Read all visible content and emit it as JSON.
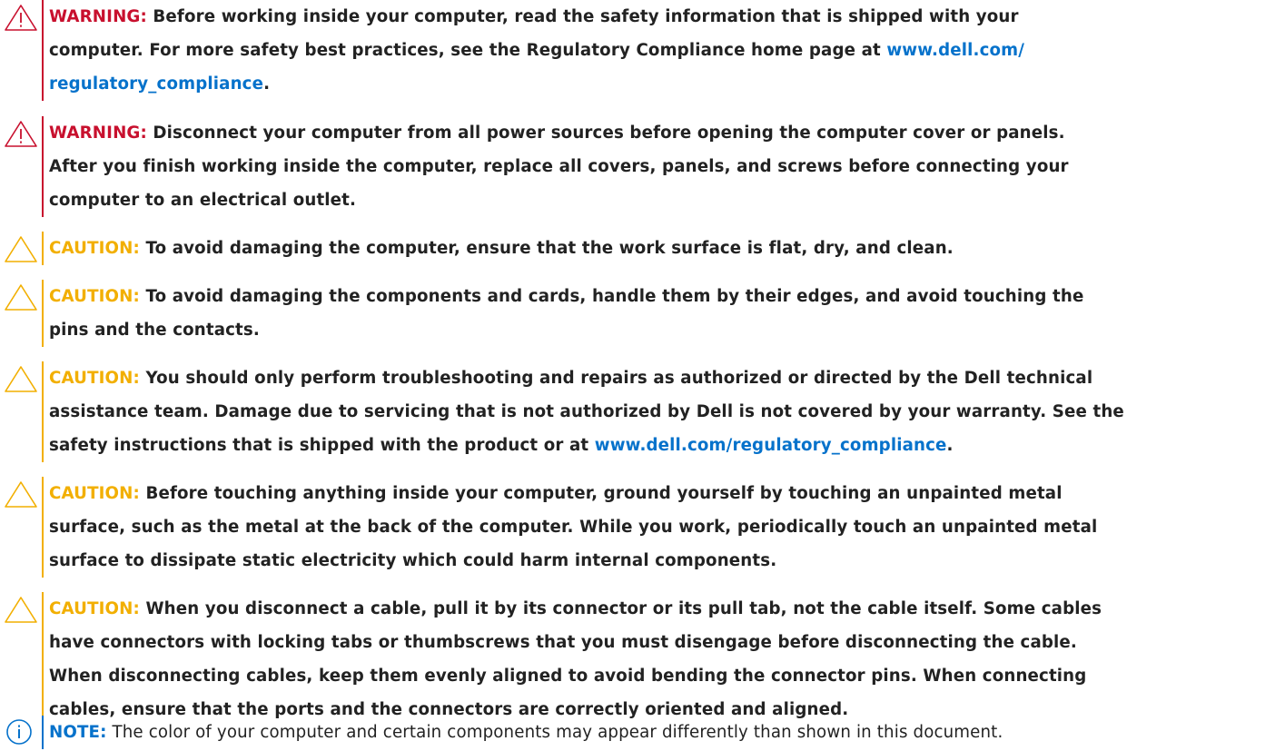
{
  "colors": {
    "warning": "#c8102e",
    "caution": "#f2af00",
    "note": "#0672cb",
    "link": "#0672cb"
  },
  "notices": [
    {
      "type": "warning",
      "icon": "warning-triangle-icon",
      "label": "WARNING:",
      "line1": "Before working inside your computer, read the safety information that is shipped with your",
      "line2": "computer. For more safety best practices, see the Regulatory Compliance home page at",
      "link_part1": "www.dell.com/",
      "link_part2": "regulatory_compliance",
      "end": "."
    },
    {
      "type": "warning",
      "icon": "warning-triangle-icon",
      "label": "WARNING:",
      "line1": "Disconnect your computer from all power sources before opening the computer cover or panels.",
      "line2": "After you finish working inside the computer, replace all covers, panels, and screws before connecting your",
      "line3": "computer to an electrical outlet."
    },
    {
      "type": "caution",
      "icon": "caution-triangle-icon",
      "label": "CAUTION:",
      "line1": "To avoid damaging the computer, ensure that the work surface is flat, dry, and clean."
    },
    {
      "type": "caution",
      "icon": "caution-triangle-icon",
      "label": "CAUTION:",
      "line1": "To avoid damaging the components and cards, handle them by their edges, and avoid touching the",
      "line2": "pins and the contacts."
    },
    {
      "type": "caution",
      "icon": "caution-triangle-icon",
      "label": "CAUTION:",
      "line1": "You should only perform troubleshooting and repairs as authorized or directed by the Dell technical",
      "line2": "assistance team. Damage due to servicing that is not authorized by Dell is not covered by your warranty. See the",
      "line3": "safety instructions that is shipped with the product or at",
      "link": "www.dell.com/regulatory_compliance",
      "end": "."
    },
    {
      "type": "caution",
      "icon": "caution-triangle-icon",
      "label": "CAUTION:",
      "line1": "Before touching anything inside your computer, ground yourself by touching an unpainted metal",
      "line2": "surface, such as the metal at the back of the computer. While you work, periodically touch an unpainted metal",
      "line3": "surface to dissipate static electricity which could harm internal components."
    },
    {
      "type": "caution",
      "icon": "caution-triangle-icon",
      "label": "CAUTION:",
      "line1": "When you disconnect a cable, pull it by its connector or its pull tab, not the cable itself. Some cables",
      "line2": "have connectors with locking tabs or thumbscrews that you must disengage before disconnecting the cable.",
      "line3": "When disconnecting cables, keep them evenly aligned to avoid bending the connector pins. When connecting",
      "line4": "cables, ensure that the ports and the connectors are correctly oriented and aligned."
    },
    {
      "type": "note",
      "icon": "info-circle-icon",
      "label": "NOTE:",
      "line1": "The color of your computer and certain components may appear differently than shown in this document."
    }
  ]
}
